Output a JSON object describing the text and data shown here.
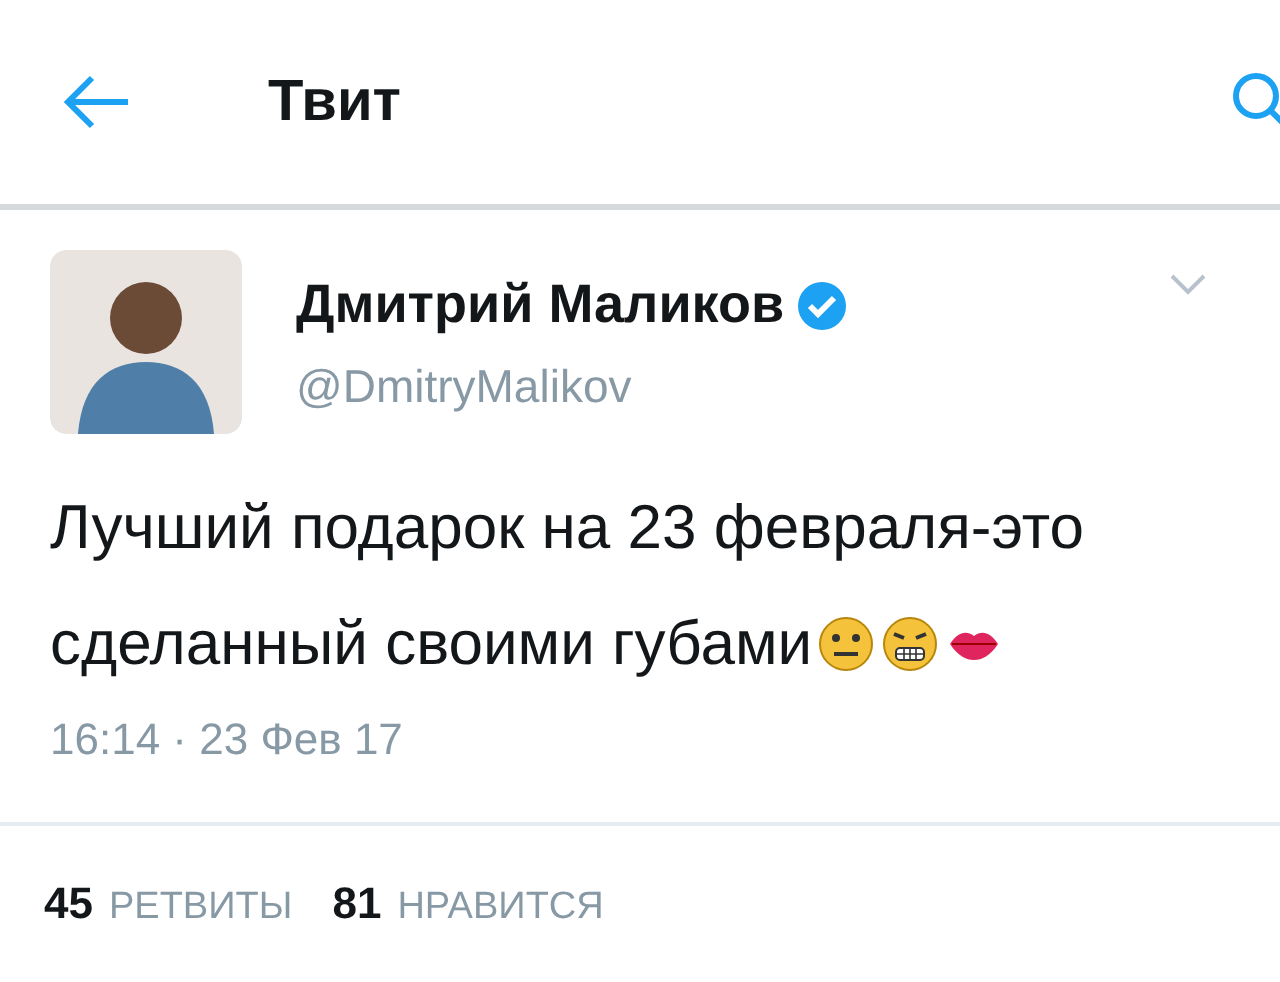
{
  "header": {
    "title": "Твит"
  },
  "tweet": {
    "name": "Дмитрий Маликов",
    "verified": true,
    "handle": "@DmitryMalikov",
    "lines": [
      "Лучший подарок на 23 февраля-это",
      "сделанный своими губами"
    ],
    "timestamp": "16:14 · 23 Фев 17"
  },
  "stats": [
    {
      "count": "45",
      "label": "РЕТВИТЫ"
    },
    {
      "count": "81",
      "label": "НРАВИТСЯ"
    }
  ]
}
